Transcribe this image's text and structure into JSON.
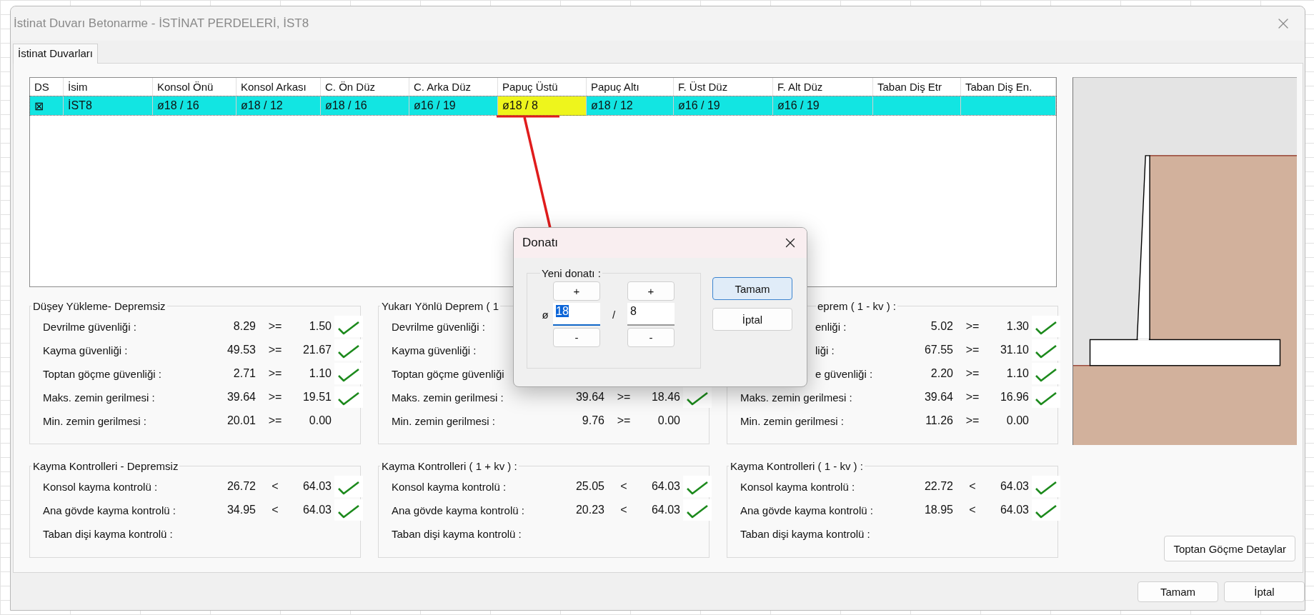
{
  "window": {
    "title": "İstinat Duvarı Betonarme - İSTİNAT PERDELERİ, İST8"
  },
  "tabs": [
    {
      "label": "İstinat Duvarları",
      "selected": true
    }
  ],
  "table": {
    "columns": [
      "DS",
      "İsim",
      "Konsol Önü",
      "Konsol Arkası",
      "C. Ön Düz",
      "C. Arka Düz",
      "Papuç Üstü",
      "Papuç Altı",
      "F. Üst Düz",
      "F. Alt Düz",
      "Taban Diş Etr",
      "Taban Diş En."
    ],
    "rows": [
      {
        "selected": true,
        "cells": [
          {
            "text": "⊠",
            "selected": false
          },
          {
            "text": "İST8",
            "selected": false
          },
          {
            "text": "ø18 / 16",
            "selected": false
          },
          {
            "text": "ø18 / 12",
            "selected": false
          },
          {
            "text": "ø18 / 16",
            "selected": false
          },
          {
            "text": "ø16 / 19",
            "selected": false
          },
          {
            "text": "ø18 / 8",
            "selected": true
          },
          {
            "text": "ø18 / 12",
            "selected": false
          },
          {
            "text": "ø16 / 19",
            "selected": false
          },
          {
            "text": "ø16 / 19",
            "selected": false
          },
          {
            "selected": false
          },
          {
            "selected": false
          }
        ]
      }
    ]
  },
  "panels": [
    {
      "title": "Düşey Yükleme- Depremsiz",
      "kind": "plain",
      "rows": [
        {
          "kind": "plain",
          "label": "Devrilme güvenliği :",
          "value": "8.29",
          "op": ">=",
          "limit": "1.50",
          "check": true
        },
        {
          "kind": "plain",
          "label": "Kayma güvenliği :",
          "value": "49.53",
          "op": ">=",
          "limit": "21.67",
          "check": true
        },
        {
          "kind": "plain",
          "label": "Toptan göçme güvenliği :",
          "value": "2.71",
          "op": ">=",
          "limit": "1.10",
          "check": true
        },
        {
          "kind": "plain",
          "label": "Maks. zemin gerilmesi :",
          "value": "39.64",
          "op": ">=",
          "limit": "19.51",
          "check": true
        },
        {
          "kind": "plain",
          "label": "Min. zemin gerilmesi :",
          "value": "20.01",
          "op": ">=",
          "limit": "0.00",
          "check": false
        }
      ]
    },
    {
      "title": "Yukarı Yönlü Deprem ( 1",
      "kind": "plain",
      "rows": [
        {
          "kind": "plain",
          "label": "Devrilme güvenliği :"
        },
        {
          "kind": "plain",
          "label": "Kayma güvenliği :"
        },
        {
          "kind": "plain",
          "label": "Toptan göçme güvenliği"
        },
        {
          "kind": "plain",
          "label": "Maks. zemin gerilmesi :",
          "value": "39.64",
          "op": ">=",
          "limit": "18.46",
          "check": true
        },
        {
          "kind": "plain",
          "label": "Min. zemin gerilmesi :",
          "value": "9.76",
          "op": ">=",
          "limit": "0.00",
          "check": false
        }
      ]
    },
    {
      "title": "eprem ( 1 - kv ) :",
      "kind": "covered",
      "rows": [
        {
          "kind": "covered",
          "label": "enliği :",
          "value": "5.02",
          "op": ">=",
          "limit": "1.30",
          "check": true
        },
        {
          "kind": "covered",
          "label": "liği :",
          "value": "67.55",
          "op": ">=",
          "limit": "31.10",
          "check": true
        },
        {
          "kind": "covered",
          "label": "e güvenliği :",
          "value": "2.20",
          "op": ">=",
          "limit": "1.10",
          "check": true
        },
        {
          "kind": "plain",
          "label": "Maks. zemin gerilmesi :",
          "value": "39.64",
          "op": ">=",
          "limit": "16.96",
          "check": true
        },
        {
          "kind": "plain",
          "label": "Min. zemin gerilmesi :",
          "value": "11.26",
          "op": ">=",
          "limit": "0.00",
          "check": false
        }
      ]
    },
    {
      "title": "Kayma Kontrolleri - Depremsiz",
      "kind": "plain",
      "rows": [
        {
          "kind": "plain",
          "label": "Konsol kayma kontrolü :",
          "value": "26.72",
          "op": "<",
          "limit": "64.03",
          "check": true
        },
        {
          "kind": "plain",
          "label": "Ana gövde kayma kontrolü :",
          "value": "34.95",
          "op": "<",
          "limit": "64.03",
          "check": true
        },
        {
          "kind": "plain",
          "label": "Taban dişi kayma kontrolü :"
        }
      ]
    },
    {
      "title": "Kayma Kontrolleri ( 1 + kv ) :",
      "kind": "plain",
      "rows": [
        {
          "kind": "plain",
          "label": "Konsol kayma kontrolü :",
          "value": "25.05",
          "op": "<",
          "limit": "64.03",
          "check": true
        },
        {
          "kind": "plain",
          "label": "Ana gövde kayma kontrolü :",
          "value": "20.23",
          "op": "<",
          "limit": "64.03",
          "check": true
        },
        {
          "kind": "plain",
          "label": "Taban dişi kayma kontrolü :"
        }
      ]
    },
    {
      "title": "Kayma Kontrolleri ( 1 - kv ) :",
      "kind": "plain",
      "rows": [
        {
          "kind": "plain",
          "label": "Konsol kayma kontrolü :",
          "value": "22.72",
          "op": "<",
          "limit": "64.03",
          "check": true
        },
        {
          "kind": "plain",
          "label": "Ana gövde kayma kontrolü :",
          "value": "18.95",
          "op": "<",
          "limit": "64.03",
          "check": true
        },
        {
          "kind": "plain",
          "label": "Taban dişi kayma kontrolü :"
        }
      ]
    }
  ],
  "side_button": "Toptan Göçme Detaylar",
  "footer_buttons": [
    {
      "label": "Tamam"
    },
    {
      "label": "İptal"
    }
  ],
  "dialog": {
    "title": "Donatı",
    "group": "Yeni donatı :",
    "prefix": "ø",
    "separator": "/",
    "fields": [
      {
        "value": "18",
        "focused": true,
        "up": "+",
        "down": "-"
      },
      {
        "value": "8",
        "focused": false,
        "up": "+",
        "down": "-"
      }
    ],
    "buttons": [
      {
        "label": "Tamam",
        "default": true
      },
      {
        "label": "İptal",
        "default": false
      }
    ]
  }
}
